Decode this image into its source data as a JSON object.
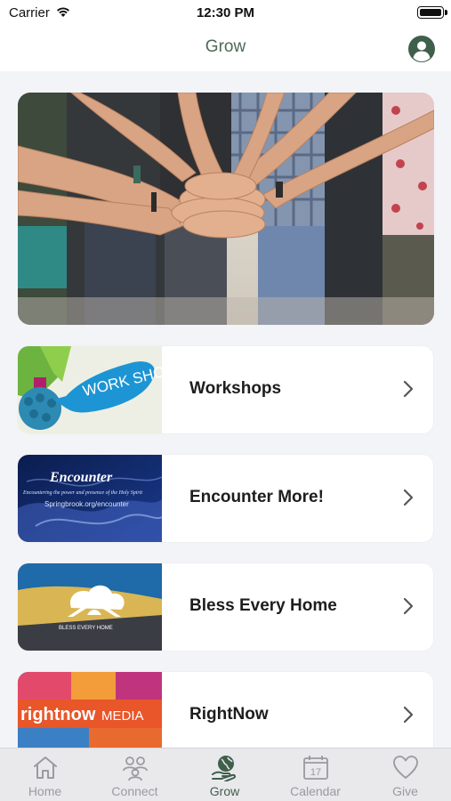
{
  "status_bar": {
    "carrier": "Carrier",
    "time": "12:30 PM"
  },
  "nav": {
    "title": "Grow",
    "profile_icon": "person-circle-icon"
  },
  "hero": {
    "image": "stacked-hands-photo"
  },
  "items": [
    {
      "label": "Workshops",
      "thumb_text": "WORK SHOPS"
    },
    {
      "label": "Encounter More!",
      "thumb_title": "Encounter",
      "thumb_sub": "Encountering the power and presence of the Holy Spirit",
      "thumb_url": "Springbrook.org/encounter"
    },
    {
      "label": "Bless Every Home",
      "thumb_text": "BLESS EVERY HOME"
    },
    {
      "label": "RightNow",
      "thumb_word1": "rightnow",
      "thumb_word2": "MEDIA"
    }
  ],
  "tabs": [
    {
      "label": "Home",
      "icon": "house-icon"
    },
    {
      "label": "Connect",
      "icon": "people-icon"
    },
    {
      "label": "Grow",
      "icon": "globe-hand-icon",
      "active": true
    },
    {
      "label": "Calendar",
      "icon": "calendar-icon",
      "day": "17"
    },
    {
      "label": "Give",
      "icon": "heart-icon"
    }
  ],
  "colors": {
    "accent": "#3f5f4b",
    "title": "#4d6a57",
    "inactive_tab": "#9a9a9f"
  }
}
